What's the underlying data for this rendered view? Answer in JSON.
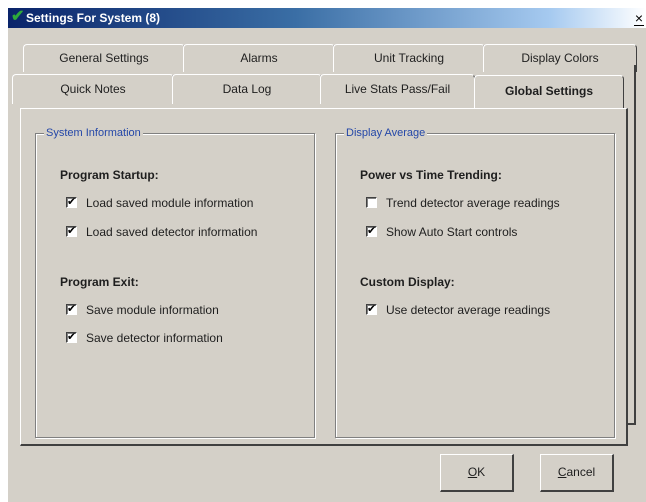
{
  "window": {
    "title": "Settings For System (8)",
    "close_symbol": "×",
    "title_icon": "check-icon",
    "title_icon_color": "#2eaa3a"
  },
  "tabs": {
    "row1": [
      "General Settings",
      "Alarms",
      "Unit Tracking",
      "Display Colors"
    ],
    "row2": [
      "Quick Notes",
      "Data Log",
      "Live Stats Pass/Fail",
      "Global Settings"
    ],
    "selected": "Global Settings"
  },
  "system_information": {
    "title": "System Information",
    "program_startup": {
      "heading": "Program Startup:",
      "options": [
        {
          "label": "Load saved module information",
          "checked": true
        },
        {
          "label": "Load saved detector information",
          "checked": true
        }
      ]
    },
    "program_exit": {
      "heading": "Program Exit:",
      "options": [
        {
          "label": "Save module information",
          "checked": true
        },
        {
          "label": "Save detector information",
          "checked": true
        }
      ]
    }
  },
  "display_average": {
    "title": "Display Average",
    "power_vs_time": {
      "heading": "Power vs Time Trending:",
      "options": [
        {
          "label": "Trend detector average readings",
          "checked": false
        },
        {
          "label": "Show Auto Start controls",
          "checked": true
        }
      ]
    },
    "custom_display": {
      "heading": "Custom Display:",
      "options": [
        {
          "label": "Use detector average readings",
          "checked": true
        }
      ]
    }
  },
  "buttons": {
    "ok": {
      "mnemonic": "O",
      "rest": "K"
    },
    "cancel": {
      "mnemonic": "C",
      "rest": "ancel"
    }
  },
  "colors": {
    "group_title": "#2447a8",
    "dialog_face": "#d4d0c8"
  }
}
